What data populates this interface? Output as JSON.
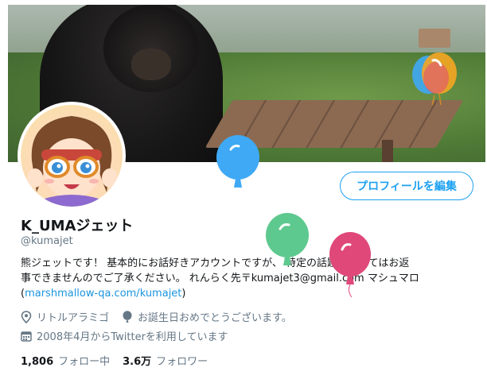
{
  "profile": {
    "display_name": "K_UMAジェット",
    "handle": "@kumajet",
    "edit_button_label": "プロフィールを編集",
    "bio_line1": "熊ジェットです！ 基本的にお話好きアカウントですが、 特定の話題についてはお返",
    "bio_line2": "事できませんのでご了承ください。 れんらく先〒kumajet3@gmail.com マシュマロ",
    "bio_link_open": "(",
    "bio_link_text": "marshmallow-qa.com/kumajet",
    "bio_link_close": ")",
    "location": "リトルアラミゴ",
    "birthday": "お誕生日おめでとうございます。",
    "joined": "2008年4月からTwitterを利用しています",
    "following_count": "1,806",
    "following_label": "フォロー中",
    "followers_count": "3.6万",
    "followers_label": "フォロワー"
  },
  "icons": {
    "location": "location-pin-icon",
    "birthday": "balloon-icon",
    "joined": "calendar-icon"
  },
  "colors": {
    "accent": "#1da1f2",
    "link": "#1b95e0",
    "secondary_text": "#657786",
    "balloon_blue": "#3fa9f5",
    "balloon_green": "#5ec98f",
    "balloon_pink": "#e0487a",
    "balloon_orange": "#f5a623"
  }
}
